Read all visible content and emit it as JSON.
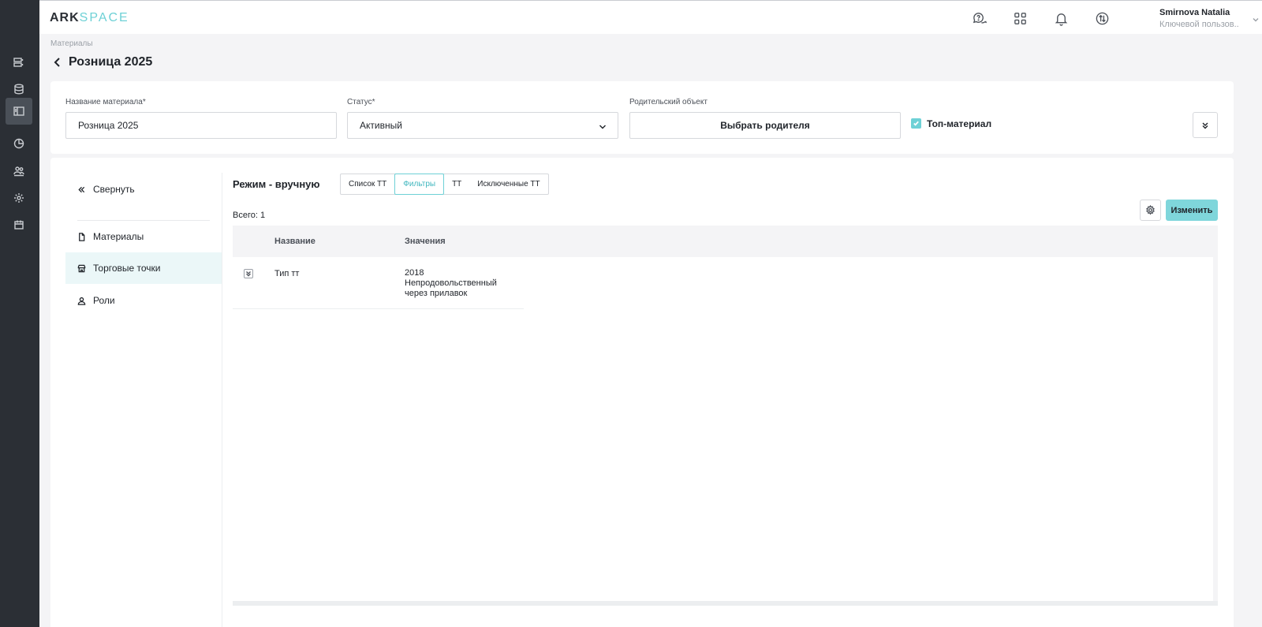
{
  "app": {
    "logo_ark": "ARK",
    "logo_space": "SPACE"
  },
  "rail": {
    "items": [
      "tasks-icon",
      "database-icon",
      "layout-icon",
      "chart-icon",
      "users-icon",
      "settings-icon",
      "calendar-icon"
    ],
    "active_index": 2
  },
  "header": {
    "icons": [
      "help-chat-icon",
      "apps-grid-icon",
      "bell-icon",
      "exchange-icon"
    ],
    "user_name": "Smirnova Natalia",
    "user_role": "Ключевой пользов..."
  },
  "breadcrumb": "Материалы",
  "page_title": "Розница 2025",
  "form": {
    "name_label": "Название материала*",
    "name_value": "Розница 2025",
    "status_label": "Статус*",
    "status_value": "Активный",
    "parent_label": "Родительский объект",
    "parent_button": "Выбрать родителя",
    "top_material_label": "Топ-материал",
    "top_material_checked": true
  },
  "side_nav": {
    "collapse": "Свернуть",
    "items": [
      {
        "label": "Материалы",
        "icon": "document-icon"
      },
      {
        "label": "Торговые точки",
        "icon": "store-icon",
        "active": true
      },
      {
        "label": "Роли",
        "icon": "user-icon"
      }
    ]
  },
  "content": {
    "mode_title": "Режим - вручную",
    "tabs": [
      {
        "label": "Список ТТ"
      },
      {
        "label": "Фильтры",
        "active": true
      },
      {
        "label": "ТТ"
      },
      {
        "label": "Исключенные ТТ"
      }
    ],
    "total": "Всего: 1",
    "edit_button": "Изменить",
    "table": {
      "columns": [
        "Название",
        "Значения"
      ],
      "rows": [
        {
          "name": "Тип тт",
          "values_line1": "2018",
          "values_line2": "Непродовольственный",
          "values_line3": "через прилавок"
        }
      ]
    }
  },
  "colors": {
    "accent": "#6ed1d6",
    "rail_bg": "#2b2f35",
    "nav_active_bg": "#ebf7f8"
  }
}
